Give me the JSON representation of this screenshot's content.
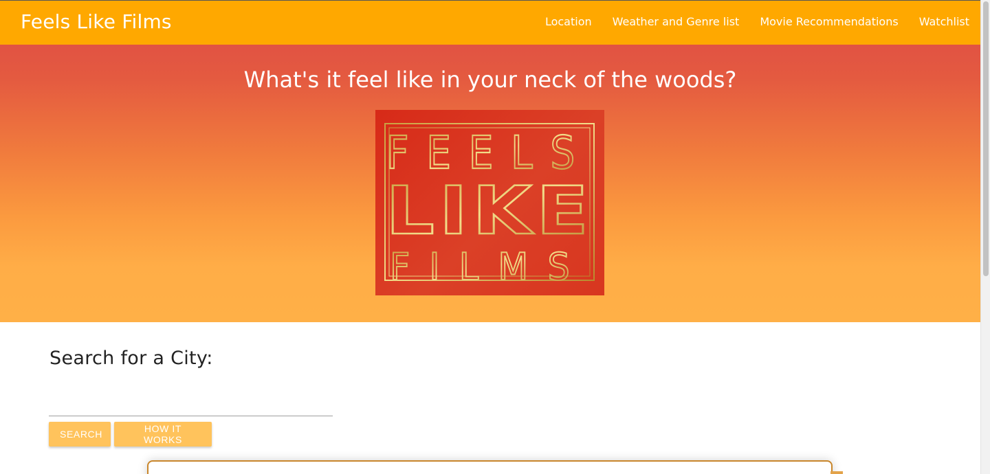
{
  "navbar": {
    "brand": "Feels Like Films",
    "links": [
      "Location",
      "Weather and Genre list",
      "Movie Recommendations",
      "Watchlist"
    ]
  },
  "hero": {
    "title": "What's it feel like in your neck of the woods?",
    "logo": {
      "line1": "FEELS",
      "line2": "LIKE",
      "line3": "FILMS"
    }
  },
  "search": {
    "heading": "Search for a City:",
    "input_value": "",
    "input_placeholder": "",
    "search_label": "Search",
    "how_label": "How it works"
  },
  "colors": {
    "navbar": "#ffa800",
    "hero_top": "#e15343",
    "hero_bottom": "#ffb047",
    "button": "#ffc35c",
    "logo_bg": "#d72a18",
    "logo_gold": "#d9b64f"
  }
}
